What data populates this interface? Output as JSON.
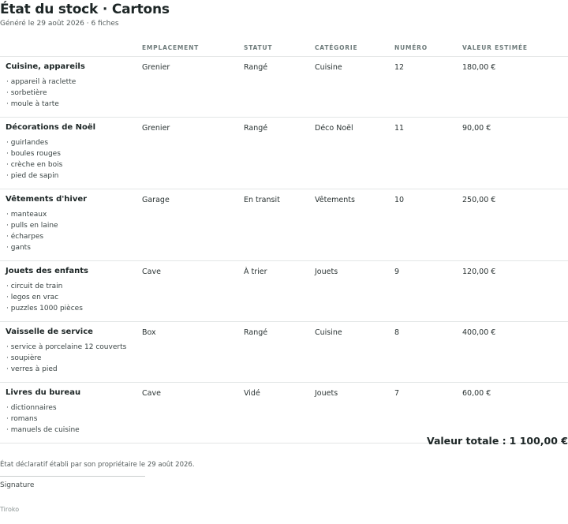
{
  "header": {
    "title": "État du stock · Cartons",
    "subtitle": "Généré le 29 août 2026 · 6 fiches"
  },
  "table": {
    "columns": [
      "EMPLACEMENT",
      "STATUT",
      "CATÉGORIE",
      "NUMÉRO",
      "VALEUR ESTIMÉE"
    ],
    "rows": [
      {
        "name": "Cuisine, appareils",
        "items": [
          "appareil à raclette",
          "sorbetière",
          "moule à tarte"
        ],
        "location": "Grenier",
        "status": "Rangé",
        "category": "Cuisine",
        "number": "12",
        "value": "180,00 €"
      },
      {
        "name": "Décorations de Noël",
        "items": [
          "guirlandes",
          "boules rouges",
          "crèche en bois",
          "pied de sapin"
        ],
        "location": "Grenier",
        "status": "Rangé",
        "category": "Déco Noël",
        "number": "11",
        "value": "90,00 €"
      },
      {
        "name": "Vêtements d'hiver",
        "items": [
          "manteaux",
          "pulls en laine",
          "écharpes",
          "gants"
        ],
        "location": "Garage",
        "status": "En transit",
        "category": "Vêtements",
        "number": "10",
        "value": "250,00 €"
      },
      {
        "name": "Jouets des enfants",
        "items": [
          "circuit de train",
          "legos en vrac",
          "puzzles 1000 pièces"
        ],
        "location": "Cave",
        "status": "À trier",
        "category": "Jouets",
        "number": "9",
        "value": "120,00 €"
      },
      {
        "name": "Vaisselle de service",
        "items": [
          "service à porcelaine 12 couverts",
          "soupière",
          "verres à pied"
        ],
        "location": "Box",
        "status": "Rangé",
        "category": "Cuisine",
        "number": "8",
        "value": "400,00 €"
      },
      {
        "name": "Livres du bureau",
        "items": [
          "dictionnaires",
          "romans",
          "manuels de cuisine"
        ],
        "location": "Cave",
        "status": "Vidé",
        "category": "Jouets",
        "number": "7",
        "value": "60,00 €"
      }
    ]
  },
  "summary": {
    "total_label": "Valeur totale :",
    "total_value": "1 100,00 €"
  },
  "footer": {
    "declaration": "État déclaratif établi par son propriétaire le 29 août 2026.",
    "signature_label": "Signature",
    "brand": "Tiroko"
  }
}
